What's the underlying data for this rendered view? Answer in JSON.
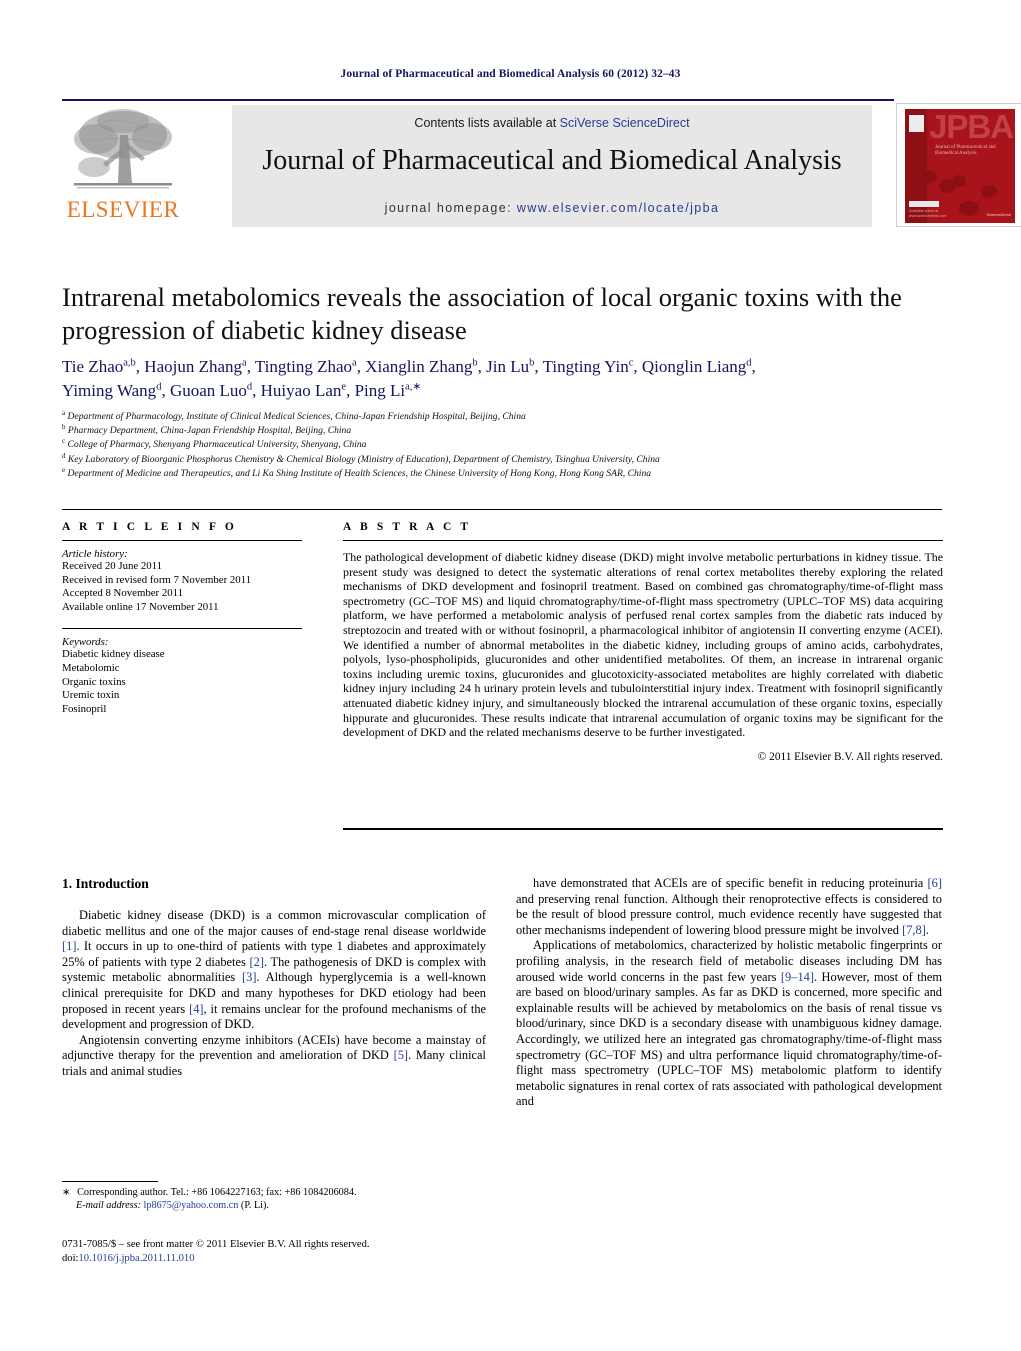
{
  "running_head": "Journal of Pharmaceutical and Biomedical Analysis 60 (2012) 32–43",
  "masthead": {
    "publisher_name": "ELSEVIER",
    "contents_prefix": "Contents lists available at ",
    "contents_link": "SciVerse ScienceDirect",
    "journal_title": "Journal of Pharmaceutical and Biomedical Analysis",
    "homepage_prefix": "journal homepage: ",
    "homepage_url": "www.elsevier.com/locate/jpba",
    "cover": {
      "acronym": "JPBA",
      "subtitle": "Journal of Pharmaceutical and Biomedical Analysis",
      "footer": "Available online at www.sciencedirect.com",
      "sciencedirect": "ScienceDirect"
    }
  },
  "article": {
    "title": "Intrarenal metabolomics reveals the association of local organic toxins with the progression of diabetic kidney disease",
    "authors_line1": "Tie Zhao<sup>a,b</sup>, Haojun Zhang<sup>a</sup>, Tingting Zhao<sup>a</sup>, Xianglin Zhang<sup>b</sup>, Jin Lu<sup>b</sup>, Tingting Yin<sup>c</sup>, Qionglin Liang<sup>d</sup>,",
    "authors_line2": "Yiming Wang<sup>d</sup>, Guoan Luo<sup>d</sup>, Huiyao Lan<sup>e</sup>, Ping Li<sup>a,</sup><sup>∗</sup>",
    "affiliations": [
      "<sup>a</sup> Department of Pharmacology, Institute of Clinical Medical Sciences, China-Japan Friendship Hospital, Beijing, China",
      "<sup>b</sup> Pharmacy Department, China-Japan Friendship Hospital, Beijing, China",
      "<sup>c</sup> College of Pharmacy, Shenyang Pharmaceutical University, Shenyang, China",
      "<sup>d</sup> Key Laboratory of Bioorganic Phosphorus Chemistry &amp; Chemical Biology (Ministry of Education), Department of Chemistry, Tsinghua University, China",
      "<sup>e</sup> Department of Medicine and Therapeutics, and Li Ka Shing Institute of Health Sciences, the Chinese University of Hong Kong, Hong Kong SAR, China"
    ]
  },
  "article_info": {
    "heading": "A R T I C L E   I N F O",
    "history_label": "Article history:",
    "history": [
      "Received 20 June 2011",
      "Received in revised form 7 November 2011",
      "Accepted 8 November 2011",
      "Available online 17 November 2011"
    ],
    "keywords_label": "Keywords:",
    "keywords": [
      "Diabetic kidney disease",
      "Metabolomic",
      "Organic toxins",
      "Uremic toxin",
      "Fosinopril"
    ]
  },
  "abstract": {
    "heading": "A B S T R A C T",
    "text": "The pathological development of diabetic kidney disease (DKD) might involve metabolic perturbations in kidney tissue. The present study was designed to detect the systematic alterations of renal cortex metabolites thereby exploring the related mechanisms of DKD development and fosinopril treatment. Based on combined gas chromatography/time-of-flight mass spectrometry (GC–TOF MS) and liquid chromatography/time-of-flight mass spectrometry (UPLC–TOF MS) data acquiring platform, we have performed a metabolomic analysis of perfused renal cortex samples from the diabetic rats induced by streptozocin and treated with or without fosinopril, a pharmacological inhibitor of angiotensin II converting enzyme (ACEI). We identified a number of abnormal metabolites in the diabetic kidney, including groups of amino acids, carbohydrates, polyols, lyso-phospholipids, glucuronides and other unidentified metabolites. Of them, an increase in intrarenal organic toxins including uremic toxins, glucuronides and glucotoxicity-associated metabolites are highly correlated with diabetic kidney injury including 24 h urinary protein levels and tubulointerstitial injury index. Treatment with fosinopril significantly attenuated diabetic kidney injury, and simultaneously blocked the intrarenal accumulation of these organic toxins, especially hippurate and glucuronides. These results indicate that intrarenal accumulation of organic toxins may be significant for the development of DKD and the related mechanisms deserve to be further investigated.",
    "copyright": "© 2011 Elsevier B.V. All rights reserved."
  },
  "body": {
    "section_heading": "1. Introduction",
    "left_paragraphs": [
      "Diabetic kidney disease (DKD) is a common microvascular complication of diabetic mellitus and one of the major causes of end-stage renal disease worldwide <span class=\"ref\">[1]</span>. It occurs in up to one-third of patients with type 1 diabetes and approximately 25% of patients with type 2 diabetes <span class=\"ref\">[2]</span>. The pathogenesis of DKD is complex with systemic metabolic abnormalities <span class=\"ref\">[3]</span>. Although hyperglycemia is a well-known clinical prerequisite for DKD and many hypotheses for DKD etiology had been proposed in recent years <span class=\"ref\">[4]</span>, it remains unclear for the profound mechanisms of the development and progression of DKD.",
      "Angiotensin converting enzyme inhibitors (ACEIs) have become a mainstay of adjunctive therapy for the prevention and amelioration of DKD <span class=\"ref\">[5]</span>. Many clinical trials and animal studies"
    ],
    "right_paragraphs": [
      "have demonstrated that ACEIs are of specific benefit in reducing proteinuria <span class=\"ref\">[6]</span> and preserving renal function. Although their renoprotective effects is considered to be the result of blood pressure control, much evidence recently have suggested that other mechanisms independent of lowering blood pressure might be involved <span class=\"ref\">[7,8]</span>.",
      "Applications of metabolomics, characterized by holistic metabolic fingerprints or profiling analysis, in the research field of metabolic diseases including DM has aroused wide world concerns in the past few years <span class=\"ref\">[9–14]</span>. However, most of them are based on blood/urinary samples. As far as DKD is concerned, more specific and explainable results will be achieved by metabolomics on the basis of renal tissue vs blood/urinary, since DKD is a secondary disease with unambiguous kidney damage. Accordingly, we utilized here an integrated gas chromatography/time-of-flight mass spectrometry (GC–TOF MS) and ultra performance liquid chromatography/time-of-flight mass spectrometry (UPLC–TOF MS) metabolomic platform to identify metabolic signatures in renal cortex of rats associated with pathological development and"
    ]
  },
  "footer": {
    "correspondence": "<span class=\"star\">∗</span> Corresponding author. Tel.: +86 1064227163; fax: +86 1084206084.",
    "email_label": "E-mail address:",
    "email": "lp8675@yahoo.com.cn",
    "email_suffix": "(P. Li).",
    "issn_line": "0731-7085/$ – see front matter © 2011 Elsevier B.V. All rights reserved.",
    "doi_label": "doi:",
    "doi": "10.1016/j.jpba.2011.11.010"
  },
  "colors": {
    "journal_blue": "#14175b",
    "link_blue": "#21409a",
    "elsevier_orange": "#e87722",
    "cover_red": "#a81419",
    "banner_gray": "#e7e7e7"
  }
}
